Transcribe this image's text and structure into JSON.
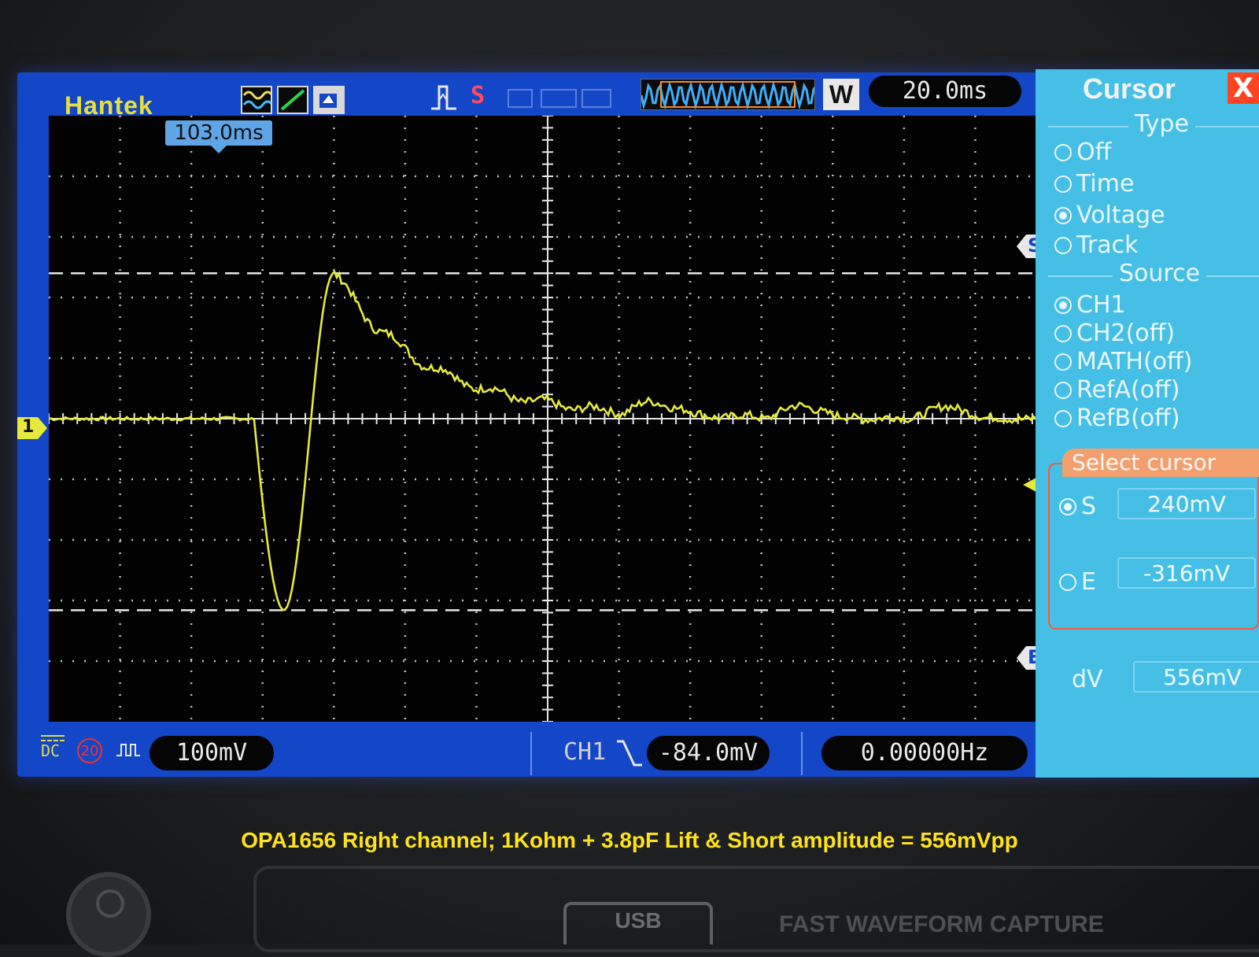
{
  "header": {
    "brand": "Hantek",
    "trigger_slope_marker": "S",
    "w_badge": "W",
    "timebase": "20.0ms",
    "trigger_position": "103.0ms"
  },
  "waveform": {
    "trace_color": "#e6ea3c",
    "cursor_s_marker": "S",
    "cursor_e_marker": "E",
    "channel_marker": "1"
  },
  "status_bar": {
    "coupling": "DC",
    "bw_limit": "20",
    "volts_per_div": "100mV",
    "trigger_source": "CH1",
    "trigger_level": "-84.0mV",
    "frequency": "0.00000Hz"
  },
  "cursor_panel": {
    "title": "Cursor",
    "close": "X",
    "type_heading": "Type",
    "type_options": [
      "Off",
      "Time",
      "Voltage",
      "Track"
    ],
    "type_selected": "Voltage",
    "source_heading": "Source",
    "source_options": [
      "CH1",
      "CH2(off)",
      "MATH(off)",
      "RefA(off)",
      "RefB(off)"
    ],
    "source_selected": "CH1",
    "select_cursor_label": "Select cursor",
    "s_label": "S",
    "s_value": "240mV",
    "e_label": "E",
    "e_value": "-316mV",
    "dv_label": "dV",
    "dv_value": "556mV"
  },
  "caption": "OPA1656 Right channel; 1Kohm + 3.8pF Lift & Short amplitude = 556mVpp",
  "front_panel": {
    "usb_label": "USB",
    "fast_capture_label": "FAST WAVEFORM CAPTURE"
  }
}
